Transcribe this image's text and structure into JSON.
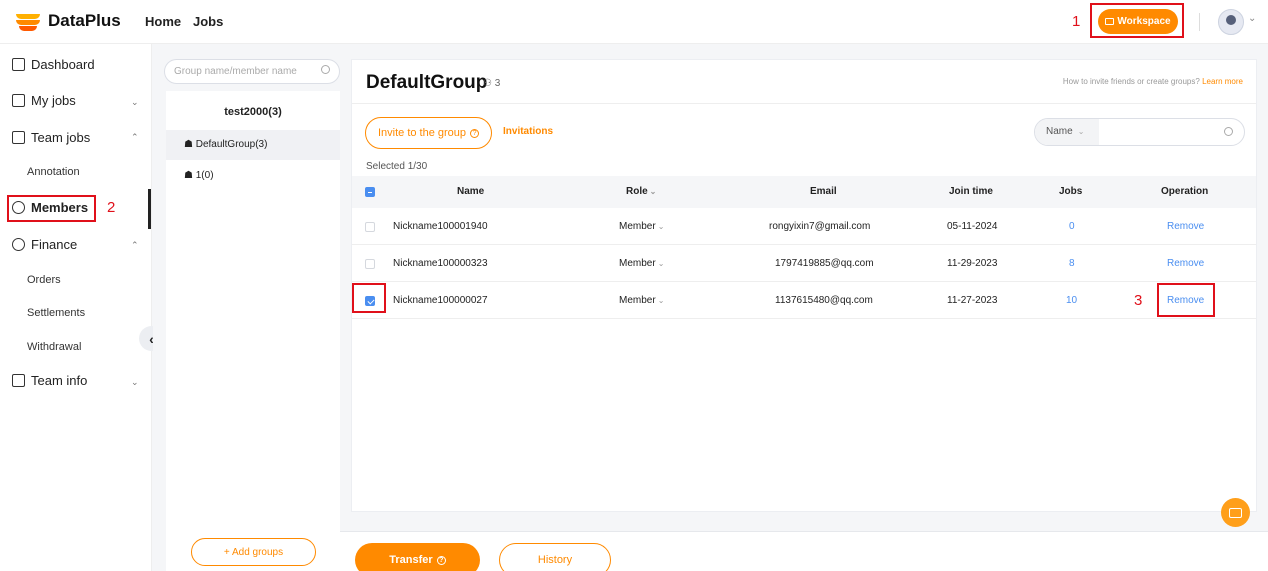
{
  "header": {
    "logo_text": "DataPlus",
    "nav": [
      "Home",
      "Jobs"
    ],
    "workspace_label": "Workspace",
    "brand_color": "#ff8a00"
  },
  "sidebar": {
    "items": [
      {
        "label": "Dashboard",
        "icon": "home-icon"
      },
      {
        "label": "My jobs",
        "icon": "jobs-icon"
      },
      {
        "label": "Team jobs",
        "icon": "team-jobs-icon"
      },
      {
        "label": "Annotation"
      },
      {
        "label": "Members",
        "icon": "members-icon"
      },
      {
        "label": "Finance",
        "icon": "finance-icon"
      },
      {
        "label": "Orders"
      },
      {
        "label": "Settlements"
      },
      {
        "label": "Withdrawal"
      },
      {
        "label": "Team info",
        "icon": "team-info-icon"
      }
    ]
  },
  "annotations": {
    "step1": "1",
    "step2": "2",
    "step3": "3"
  },
  "groups": {
    "search_placeholder": "Group name/member name",
    "title": "test2000(3)",
    "list": [
      "DefaultGroup(3)",
      "1(0)"
    ],
    "add_label": "+ Add groups"
  },
  "main": {
    "title": "DefaultGroup",
    "member_count": "3",
    "help_text": "How to invite friends or create groups?",
    "help_link": "Learn more",
    "invite_label": "Invite to the group",
    "invitations_label": "Invitations",
    "search_field": "Name",
    "selected_text": "Selected 1/30",
    "columns": [
      "Name",
      "Role",
      "Email",
      "Join time",
      "Jobs",
      "Operation"
    ],
    "rows": [
      {
        "name": "Nickname100001940",
        "role": "Member",
        "email": "rongyixin7@gmail.com",
        "join": "05-11-2024",
        "jobs": "0",
        "op": "Remove",
        "checked": false
      },
      {
        "name": "Nickname100000323",
        "role": "Member",
        "email": "1797419885@qq.com",
        "join": "11-29-2023",
        "jobs": "8",
        "op": "Remove",
        "checked": false
      },
      {
        "name": "Nickname100000027",
        "role": "Member",
        "email": "1137615480@qq.com",
        "join": "11-27-2023",
        "jobs": "10",
        "op": "Remove",
        "checked": true
      }
    ]
  },
  "bottom": {
    "transfer_label": "Transfer",
    "history_label": "History"
  }
}
